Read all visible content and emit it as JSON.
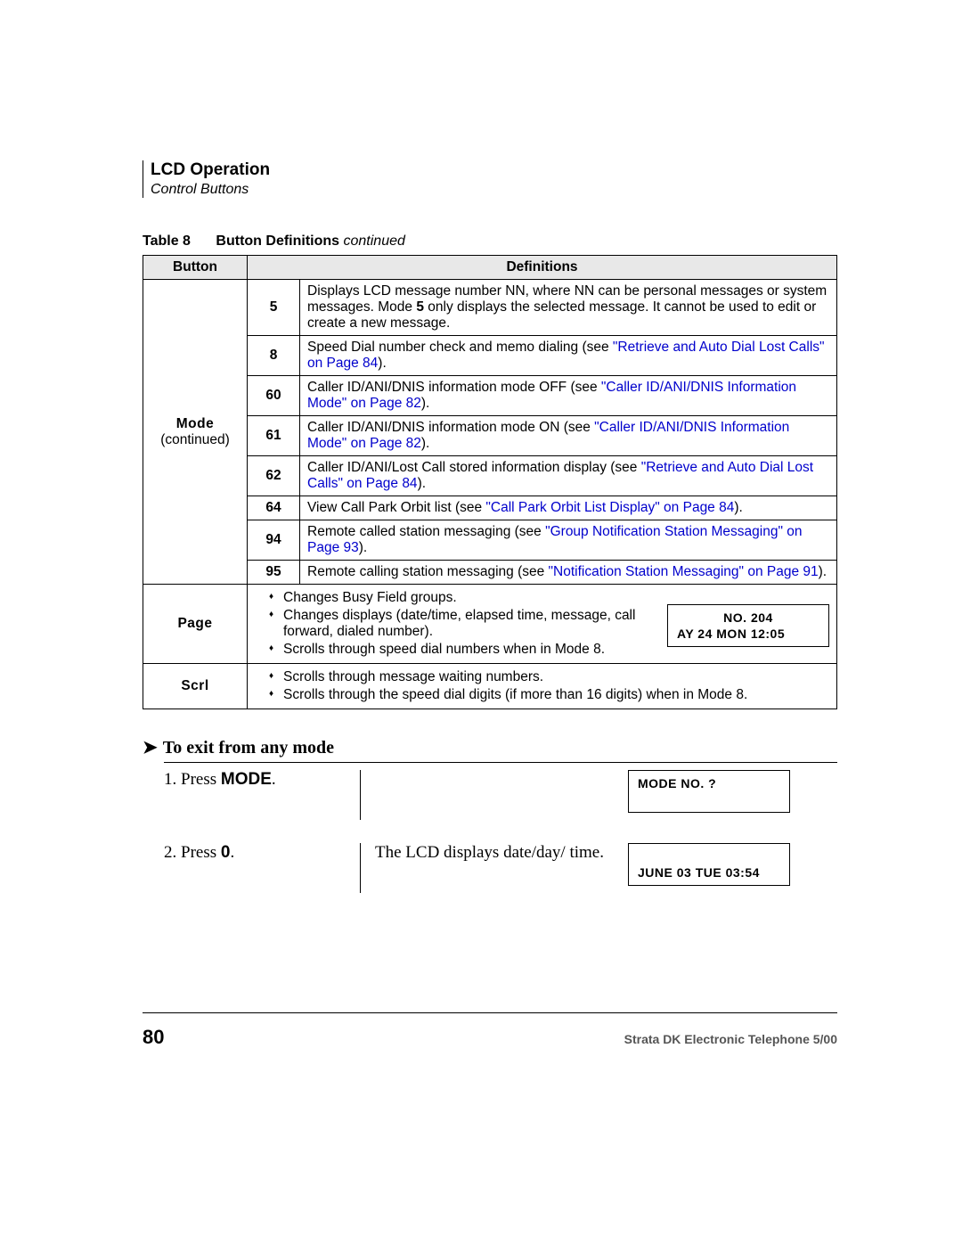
{
  "header": {
    "title": "LCD Operation",
    "subtitle": "Control Buttons"
  },
  "table": {
    "caption_label": "Table 8",
    "caption_title": "Button Definitions",
    "caption_cont": "continued",
    "headers": {
      "col1": "Button",
      "col2": "Definitions"
    },
    "mode_button": {
      "name": "Mode",
      "cont": "(continued)"
    },
    "rows": [
      {
        "num": "5",
        "text_before": "Displays LCD message number NN, where NN can be personal messages or system messages. Mode ",
        "bold_inline": "5",
        "text_after": " only displays the selected message. It cannot be used to edit or create a new message."
      },
      {
        "num": "8",
        "text": "Speed Dial number check and memo dialing (see ",
        "xref": "\"Retrieve and Auto Dial Lost Calls\" on Page 84",
        "tail": ")."
      },
      {
        "num": "60",
        "text": "Caller ID/ANI/DNIS information mode OFF (see ",
        "xref": "\"Caller ID/ANI/DNIS Information Mode\" on Page 82",
        "tail": ")."
      },
      {
        "num": "61",
        "text": "Caller ID/ANI/DNIS information mode ON (see ",
        "xref": "\"Caller ID/ANI/DNIS Information Mode\" on Page 82",
        "tail": ")."
      },
      {
        "num": "62",
        "text": "Caller ID/ANI/Lost Call stored information display (see ",
        "xref": "\"Retrieve and Auto Dial Lost Calls\" on Page 84",
        "tail": ")."
      },
      {
        "num": "64",
        "text": "View Call Park Orbit list (see ",
        "xref": "\"Call Park Orbit List Display\" on Page 84",
        "tail": ")."
      },
      {
        "num": "94",
        "text": "Remote called station messaging (see ",
        "xref": "\"Group Notification Station Messaging\" on Page 93",
        "tail": ")."
      },
      {
        "num": "95",
        "text": "Remote calling station messaging (see ",
        "xref": "\"Notification Station Messaging\" on Page 91",
        "tail": ")."
      }
    ],
    "page_button": "Page",
    "page_bullets": [
      "Changes Busy Field groups.",
      "Changes displays (date/time, elapsed time, message, call forward, dialed number).",
      "Scrolls through speed dial numbers when in Mode 8."
    ],
    "page_lcd": {
      "line1": "NO. 204",
      "line2": "AY 24 MON 12:05"
    },
    "scrl_button": "Scrl",
    "scrl_bullets": [
      "Scrolls through message waiting numbers.",
      "Scrolls through the speed dial digits (if more than 16 digits) when in Mode 8."
    ]
  },
  "procedure": {
    "heading": "To exit from any mode",
    "steps": [
      {
        "num": "1.",
        "action_pre": "Press ",
        "action_btn": "MODE",
        "action_post": ".",
        "desc": "",
        "lcd": {
          "line1": "MODE NO. ?",
          "line2": ""
        }
      },
      {
        "num": "2.",
        "action_pre": "Press ",
        "action_btn": "0",
        "action_post": ".",
        "desc": "The LCD displays date/day/ time.",
        "lcd": {
          "line1": "",
          "line2": "JUNE 03 TUE 03:54"
        }
      }
    ]
  },
  "footer": {
    "page_num": "80",
    "text": "Strata DK Electronic Telephone 5/00"
  }
}
